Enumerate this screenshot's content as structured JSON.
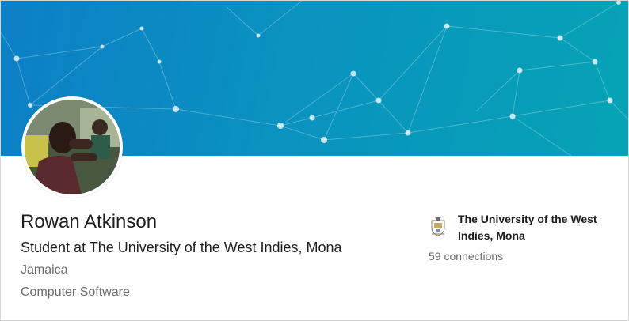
{
  "profile": {
    "name": "Rowan Atkinson",
    "headline": "Student at The University of the West Indies, Mona",
    "location": "Jamaica",
    "industry": "Computer Software"
  },
  "education": {
    "school": "The University of the West Indies, Mona",
    "logo_icon": "university-crest-icon"
  },
  "connections": "59 connections",
  "colors": {
    "banner_start": "#0d7fc6",
    "banner_end": "#06a3b5",
    "primary_text": "#1d1d1d",
    "secondary_text": "#6b6b6b"
  }
}
